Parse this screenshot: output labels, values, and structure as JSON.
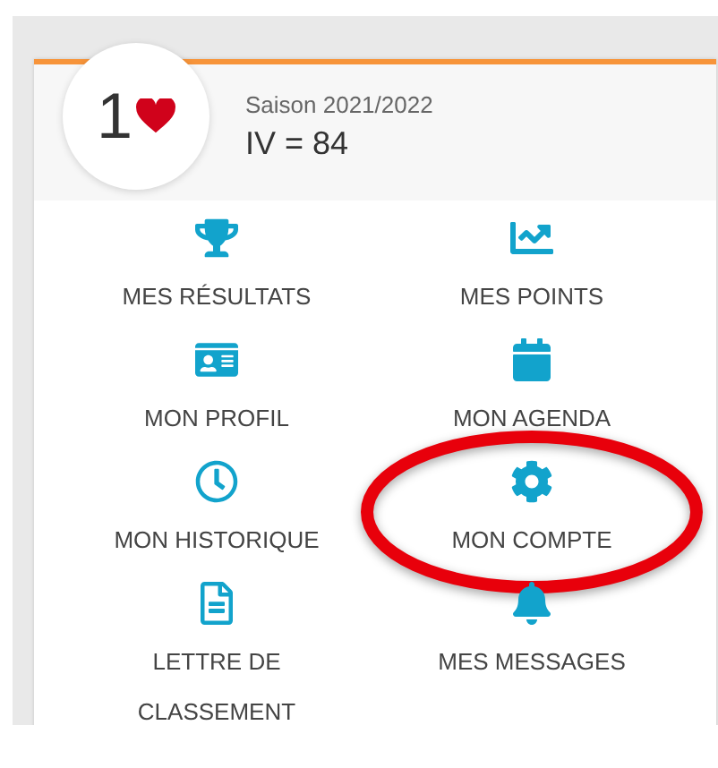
{
  "header": {
    "rank": "1",
    "season": "Saison 2021/2022",
    "value": "IV = 84"
  },
  "menu": [
    {
      "label": "MES RÉSULTATS",
      "highlighted": false
    },
    {
      "label": "MES POINTS",
      "highlighted": false
    },
    {
      "label": "MON PROFIL",
      "highlighted": false
    },
    {
      "label": "MON AGENDA",
      "highlighted": false
    },
    {
      "label": "MON HISTORIQUE",
      "highlighted": false
    },
    {
      "label": "MON COMPTE",
      "highlighted": true
    },
    {
      "label": "LETTRE DE CLASSEMENT",
      "highlighted": false
    },
    {
      "label": "MES MESSAGES",
      "highlighted": false
    }
  ]
}
